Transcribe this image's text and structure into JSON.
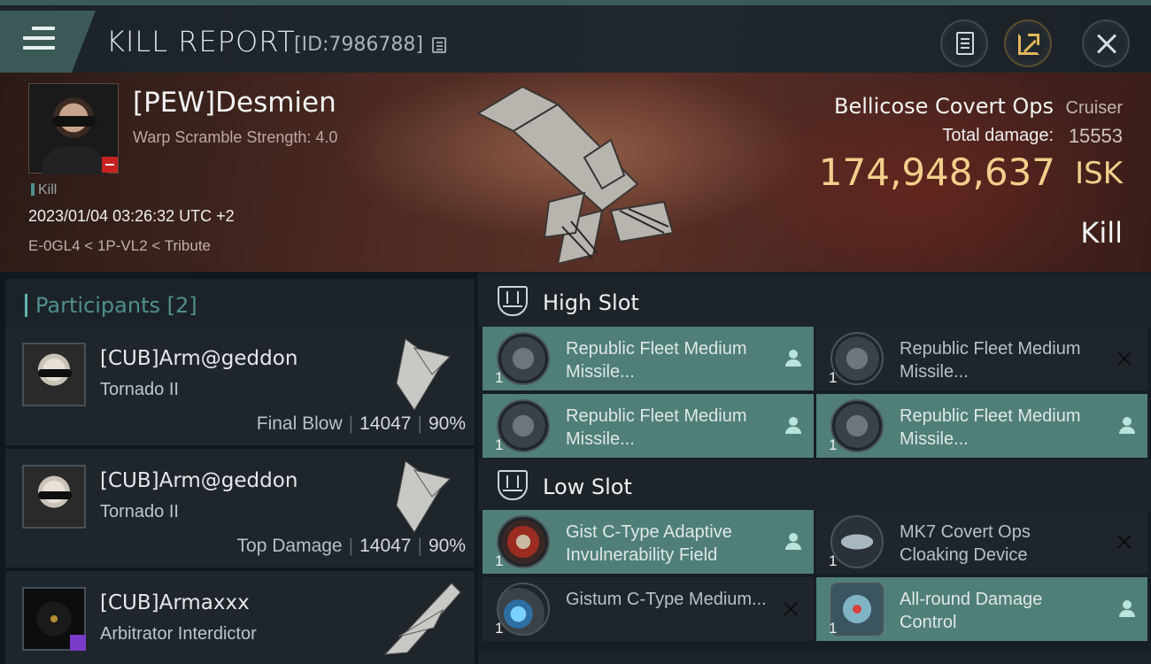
{
  "header": {
    "title": "KILL REPORT",
    "report_id": "[ID:7986788]",
    "icons": [
      "menu-icon",
      "copy-icon",
      "clipboard-icon",
      "share-icon",
      "close-icon"
    ]
  },
  "victim": {
    "name": "[PEW]Desmien",
    "warp_scramble": "Warp Scramble Strength: 4.0",
    "kill_tag": "Kill",
    "timestamp": "2023/01/04 03:26:32 UTC +2",
    "location": "E-0GL4 < 1P-VL2 < Tribute",
    "ship_name": "Bellicose Covert Ops",
    "ship_class": "Cruiser",
    "total_damage_label": "Total damage:",
    "total_damage_value": "15553",
    "isk_value": "174,948,637",
    "isk_unit": "ISK",
    "result": "Kill"
  },
  "participants": {
    "title": "Participants [2]",
    "items": [
      {
        "name": "[CUB]Arm@geddon",
        "ship": "Tornado II",
        "label": "Final Blow",
        "damage": "14047",
        "percent": "90%"
      },
      {
        "name": "[CUB]Arm@geddon",
        "ship": "Tornado II",
        "label": "Top Damage",
        "damage": "14047",
        "percent": "90%"
      },
      {
        "name": "[CUB]Armaxxx",
        "ship": "Arbitrator Interdictor"
      }
    ]
  },
  "fittings": {
    "high_slot": {
      "title": "High Slot",
      "modules": [
        {
          "name": "Republic Fleet Medium Missile...",
          "qty": "1",
          "state": "active",
          "marker": "owner-icon"
        },
        {
          "name": "Republic Fleet Medium Missile...",
          "qty": "1",
          "state": "inactive",
          "marker": "x-icon"
        },
        {
          "name": "Republic Fleet Medium Missile...",
          "qty": "1",
          "state": "active",
          "marker": "owner-icon"
        },
        {
          "name": "Republic Fleet Medium Missile...",
          "qty": "1",
          "state": "active",
          "marker": "owner-icon"
        }
      ]
    },
    "low_slot": {
      "title": "Low Slot",
      "modules": [
        {
          "name": "Gist C-Type Adaptive Invulnerability Field",
          "qty": "1",
          "state": "active",
          "marker": "owner-icon"
        },
        {
          "name": "MK7 Covert Ops Cloaking Device",
          "qty": "1",
          "state": "inactive",
          "marker": "x-icon"
        },
        {
          "name": "Gistum C-Type Medium...",
          "qty": "1",
          "state": "inactive",
          "marker": "x-icon"
        },
        {
          "name": "All-round Damage Control",
          "qty": "1",
          "state": "active",
          "marker": "owner-icon"
        }
      ]
    }
  },
  "colors": {
    "accent_teal": "#4f7f78",
    "isk_gold": "#f2cf8c",
    "header_teal": "#3b5956"
  }
}
